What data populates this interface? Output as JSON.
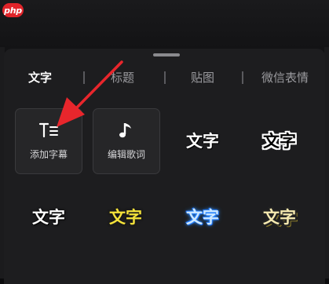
{
  "watermark": {
    "text": "php"
  },
  "tabs": [
    {
      "label": "文字",
      "active": true
    },
    {
      "label": "标题",
      "active": false
    },
    {
      "label": "贴图",
      "active": false
    },
    {
      "label": "微信表情",
      "active": false
    }
  ],
  "actions": [
    {
      "label": "添加字幕",
      "icon": "text-lines-icon"
    },
    {
      "label": "编辑歌词",
      "icon": "music-note-icon"
    }
  ],
  "text_styles": [
    {
      "text": "文字",
      "style": "plain-shadow"
    },
    {
      "text": "文字",
      "style": "black-white-outline"
    },
    {
      "text": "文字",
      "style": "plain-white"
    },
    {
      "text": "文字",
      "style": "yellow-outline"
    },
    {
      "text": "文字",
      "style": "blue-glow"
    },
    {
      "text": "文字",
      "style": "cream-outline"
    }
  ],
  "colors": {
    "annotation_arrow": "#e8262c",
    "sheet": "#1d1d1f"
  }
}
